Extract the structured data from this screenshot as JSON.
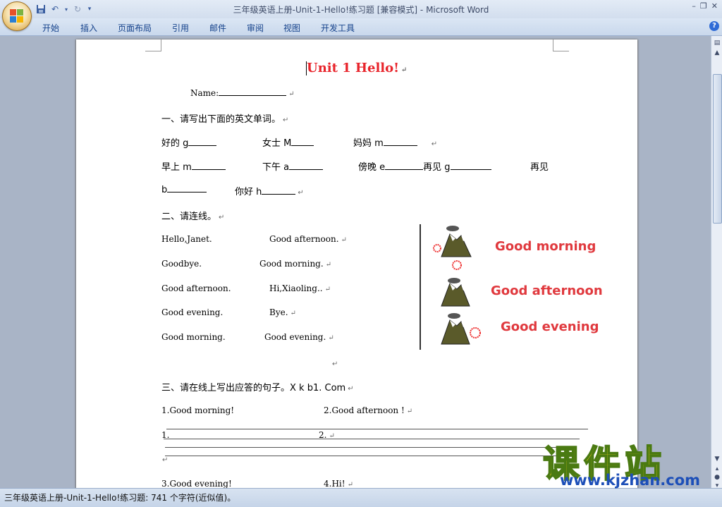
{
  "window": {
    "title": "三年级英语上册-Unit-1-Hello!练习题 [兼容模式] - Microsoft Word"
  },
  "ribbon": {
    "tabs": [
      "开始",
      "插入",
      "页面布局",
      "引用",
      "邮件",
      "审阅",
      "视图",
      "开发工具"
    ]
  },
  "document": {
    "title": "Unit 1 Hello!",
    "name_label": "Name:",
    "section1": {
      "heading": "一、请写出下面的英文单词。",
      "row1": [
        "好的 g",
        "女士 M",
        "妈妈 m"
      ],
      "row2": [
        "早上 m",
        "下午 a",
        "傍晚 e",
        "再见 g",
        "再见"
      ],
      "row3": [
        "b",
        "你好 h"
      ]
    },
    "section2": {
      "heading": "二、请连线。",
      "left": [
        "Hello,Janet.",
        "Goodbye.",
        "Good afternoon.",
        "Good evening.",
        "Good morning."
      ],
      "right": [
        "Good afternoon.",
        "Good morning.",
        "Hi,Xiaoling..",
        "Bye.",
        "Good evening."
      ],
      "pictures": [
        "Good morning",
        "Good afternoon",
        "Good evening"
      ]
    },
    "section3": {
      "heading": "三、请在线上写出应答的句子。X k b1. Com",
      "q1": "1.Good morning!",
      "q2": "2.Good afternoon !",
      "a1": "1.",
      "a2": "2.",
      "q3": "3.Good evening!",
      "q4": "4.Hi!"
    }
  },
  "status": {
    "text": "三年级英语上册-Unit-1-Hello!练习题: 741 个字符(近似值)。"
  },
  "watermark": {
    "text": "课件站",
    "url": "www.kjzhan.com"
  },
  "colors": {
    "title_red": "#e8242b",
    "ribbon_text": "#15428b",
    "picture_text": "#e0393e"
  }
}
